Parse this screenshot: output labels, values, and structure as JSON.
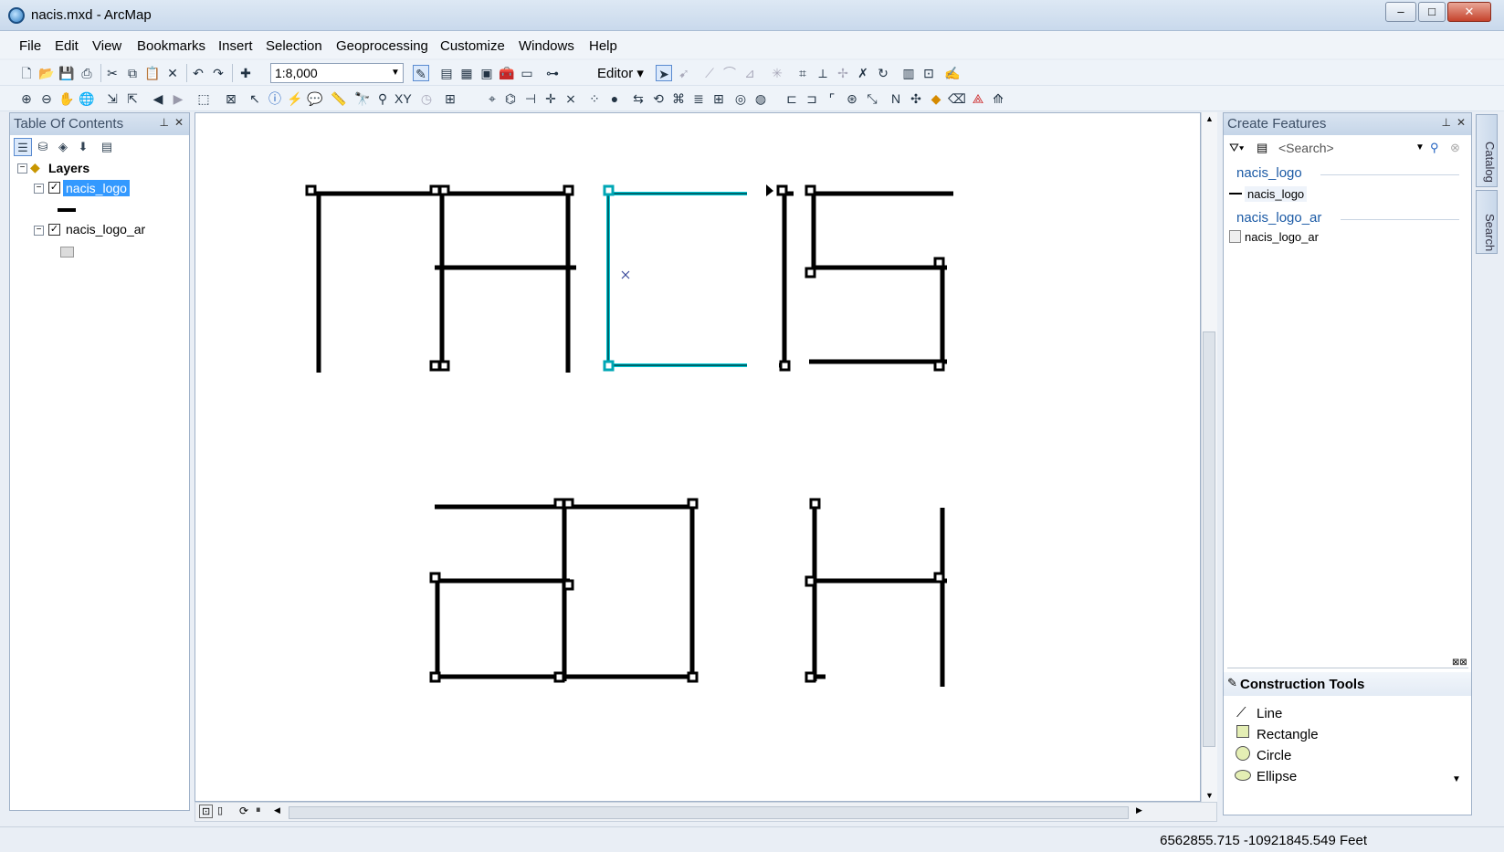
{
  "window": {
    "title": "nacis.mxd - ArcMap",
    "controls": [
      "minimize",
      "maximize",
      "close"
    ]
  },
  "menu": [
    "File",
    "Edit",
    "View",
    "Bookmarks",
    "Insert",
    "Selection",
    "Geoprocessing",
    "Customize",
    "Windows",
    "Help"
  ],
  "toolbar": {
    "scale": "1:8,000",
    "editor_label": "Editor"
  },
  "toc": {
    "title": "Table Of Contents",
    "root": "Layers",
    "layers": [
      {
        "name": "nacis_logo",
        "checked": true,
        "selected": true,
        "symbol": "line"
      },
      {
        "name": "nacis_logo_ar",
        "checked": true,
        "selected": false,
        "symbol": "polygon"
      }
    ]
  },
  "create_features": {
    "title": "Create Features",
    "search_placeholder": "<Search>",
    "groups": [
      {
        "name": "nacis_logo",
        "template": "nacis_logo",
        "symbol": "line"
      },
      {
        "name": "nacis_logo_ar",
        "template": "nacis_logo_ar",
        "symbol": "polygon"
      }
    ],
    "construction_tools_title": "Construction Tools",
    "construction_tools": [
      "Line",
      "Rectangle",
      "Circle",
      "Ellipse"
    ]
  },
  "side_tabs": [
    "Catalog",
    "Search"
  ],
  "status": {
    "coordinates": "6562855.715  -10921845.549 Feet"
  },
  "colors": {
    "selection": "#00c8d6",
    "selected_layer_bg": "#3399ff",
    "feature_line": "#000000"
  }
}
